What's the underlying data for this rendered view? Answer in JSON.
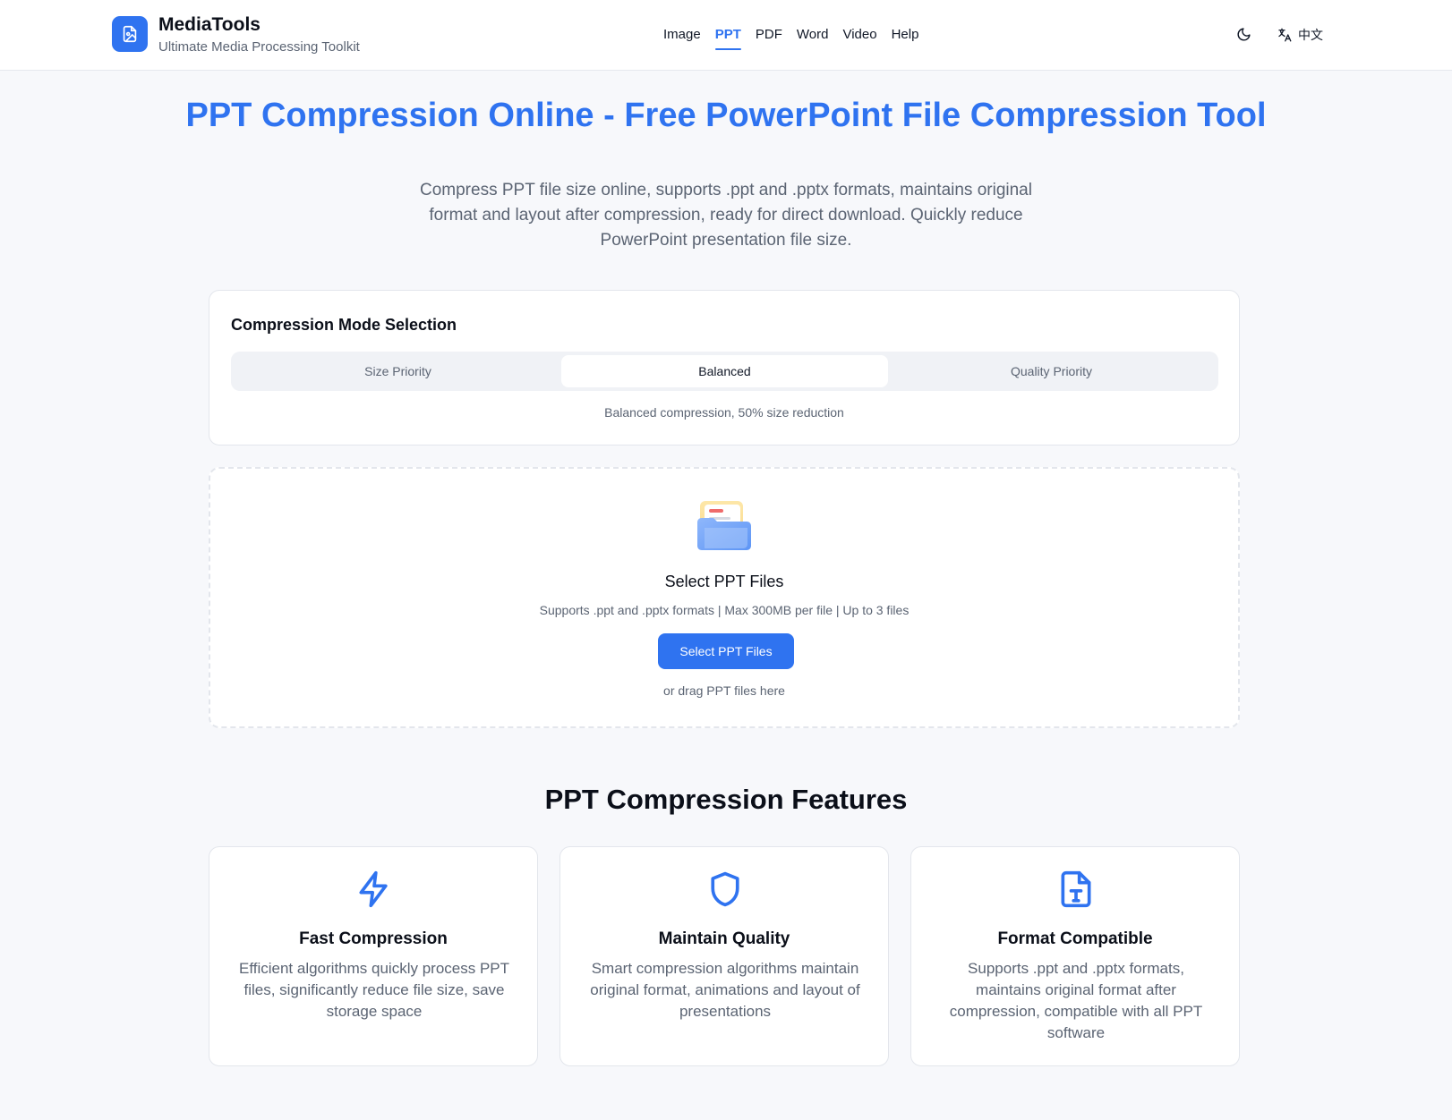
{
  "header": {
    "brand_name": "MediaTools",
    "brand_tagline": "Ultimate Media Processing Toolkit",
    "nav": [
      {
        "label": "Image",
        "active": false
      },
      {
        "label": "PPT",
        "active": true
      },
      {
        "label": "PDF",
        "active": false
      },
      {
        "label": "Word",
        "active": false
      },
      {
        "label": "Video",
        "active": false
      },
      {
        "label": "Help",
        "active": false
      }
    ],
    "theme_icon": "moon-icon",
    "language": {
      "icon": "translate-icon",
      "label": "中文"
    }
  },
  "hero": {
    "title": "PPT Compression Online - Free PowerPoint File Compression Tool",
    "description": "Compress PPT file size online, supports .ppt and .pptx formats, maintains original format and layout after compression, ready for direct download. Quickly reduce PowerPoint presentation file size."
  },
  "mode": {
    "title": "Compression Mode Selection",
    "options": [
      "Size Priority",
      "Balanced",
      "Quality Priority"
    ],
    "selected": "Balanced",
    "description": "Balanced compression, 50% size reduction"
  },
  "upload": {
    "icon": "folder-file-icon",
    "title": "Select PPT Files",
    "subtitle": "Supports .ppt and .pptx formats | Max 300MB per file | Up to 3 files",
    "button_label": "Select PPT Files",
    "drag_hint": "or drag PPT files here"
  },
  "features": {
    "title": "PPT Compression Features",
    "items": [
      {
        "icon": "lightning-icon",
        "title": "Fast Compression",
        "description": "Efficient algorithms quickly process PPT files, significantly reduce file size, save storage space"
      },
      {
        "icon": "shield-icon",
        "title": "Maintain Quality",
        "description": "Smart compression algorithms maintain original format, animations and layout of presentations"
      },
      {
        "icon": "text-file-icon",
        "title": "Format Compatible",
        "description": "Supports .ppt and .pptx formats, maintains original format after compression, compatible with all PPT software"
      }
    ]
  },
  "colors": {
    "accent": "#2f73f0",
    "muted_text": "#5b6473",
    "page_bg": "#f7f8fb"
  }
}
